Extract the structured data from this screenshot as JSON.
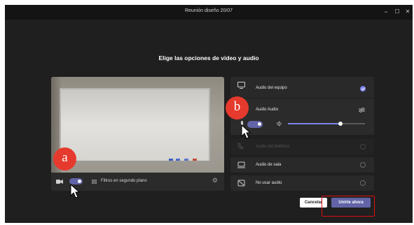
{
  "window": {
    "title": "Reunión diseño 20/07",
    "controls": [
      "−",
      "☐",
      "✕"
    ]
  },
  "heading": "Elige las opciones de video y audio",
  "video_preview": {
    "camera_toggle_on": true,
    "background_filters_label": "Filtros en segundo plano"
  },
  "audio_options": [
    {
      "label": "Audio del equipo",
      "icon": "computer-icon",
      "selected": true
    },
    {
      "label": "Audio Audio",
      "icon": "microphone-icon",
      "settings_icon": "sliders-icon",
      "mic_toggle_on": true,
      "speaker_icon": "speaker-icon",
      "volume_level": 0.68
    },
    {
      "label": "Audio del teléfono",
      "icon": "phone-icon",
      "selected": false,
      "disabled": true
    },
    {
      "label": "Audio de sala",
      "icon": "room-icon",
      "selected": false
    },
    {
      "label": "No usar audio",
      "icon": "no-audio-icon",
      "selected": false
    }
  ],
  "buttons": {
    "cancel": "Cancelar",
    "join": "Unirte ahora"
  },
  "annotations": {
    "a": "a",
    "b": "b"
  },
  "colors": {
    "accent": "#6264a7",
    "annotation_red": "#e53a2d",
    "background": "#1f1f1f"
  }
}
